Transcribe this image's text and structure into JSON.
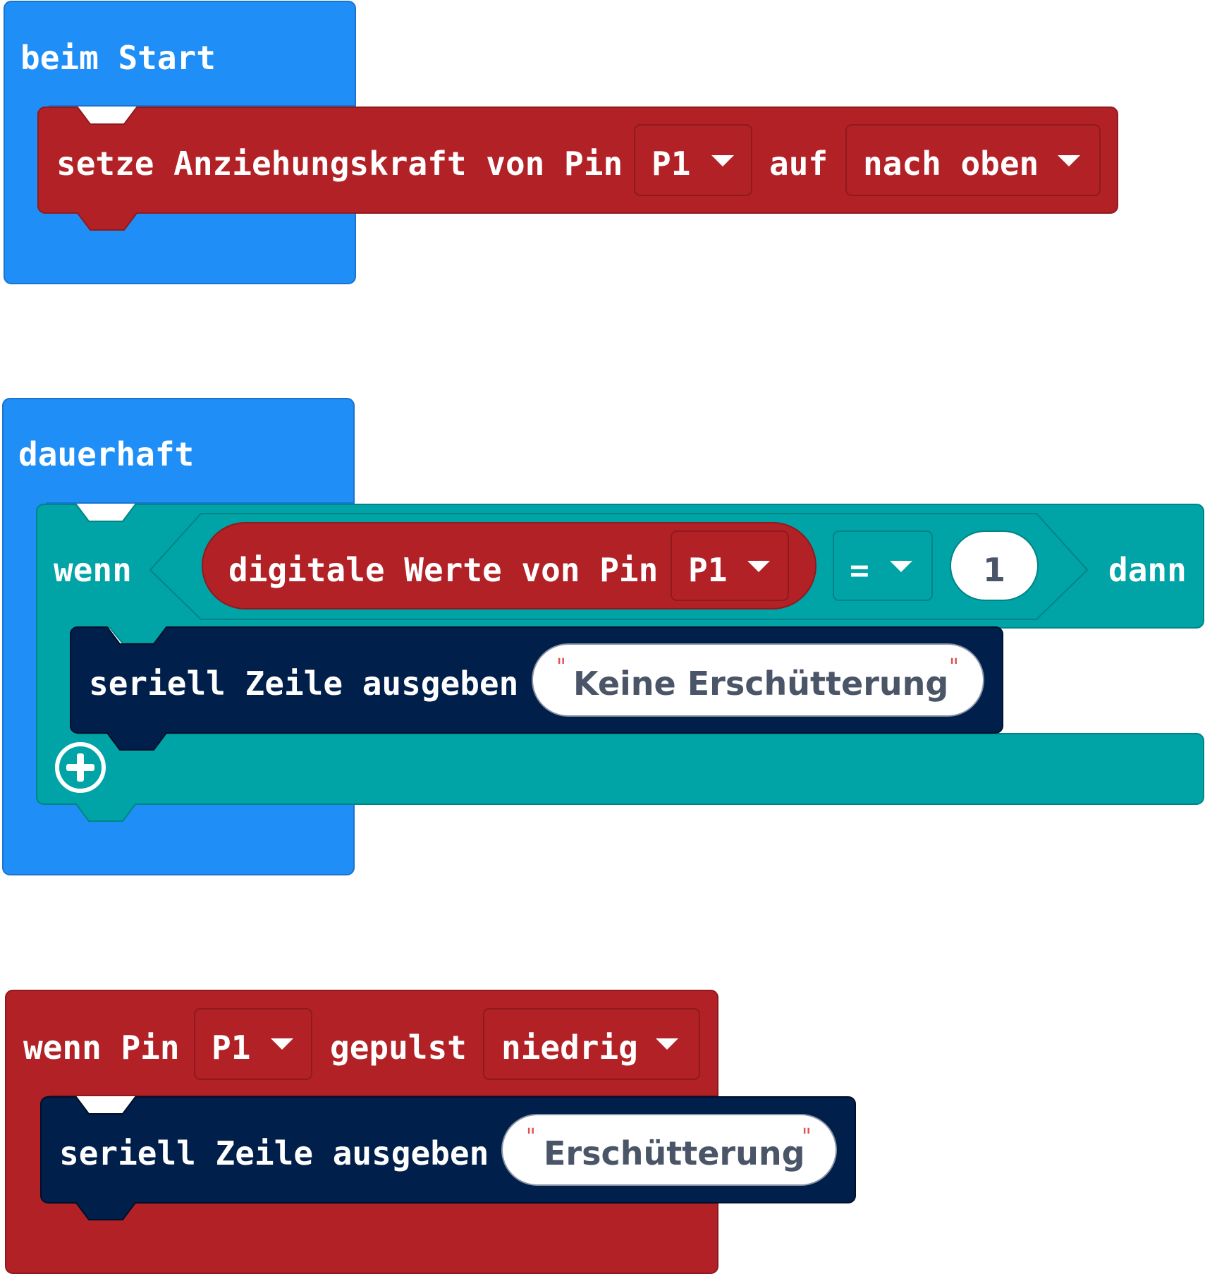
{
  "colors": {
    "events": "#1f8ff7",
    "pins": "#b22126",
    "logic": "#00a3a6",
    "serial": "#011f4b",
    "value_text": "#4a5568"
  },
  "on_start": {
    "label": "beim Start",
    "set_pull": {
      "label": "setze Anziehungskraft von Pin",
      "pin": "P1",
      "to_label": "auf",
      "mode": "nach oben"
    }
  },
  "forever": {
    "label": "dauerhaft",
    "if_block": {
      "if_label": "wenn",
      "condition": {
        "read_label": "digitale Werte von Pin",
        "pin": "P1",
        "operator": "=",
        "value": "1"
      },
      "then_label": "dann",
      "body": {
        "label": "seriell Zeile ausgeben",
        "text": "Keine Erschütterung"
      },
      "add_icon": "plus-circle-icon"
    }
  },
  "on_pulsed": {
    "label": "wenn Pin",
    "pin": "P1",
    "pulsed_label": "gepulst",
    "level": "niedrig",
    "body": {
      "label": "seriell Zeile ausgeben",
      "text": "Erschütterung"
    }
  }
}
